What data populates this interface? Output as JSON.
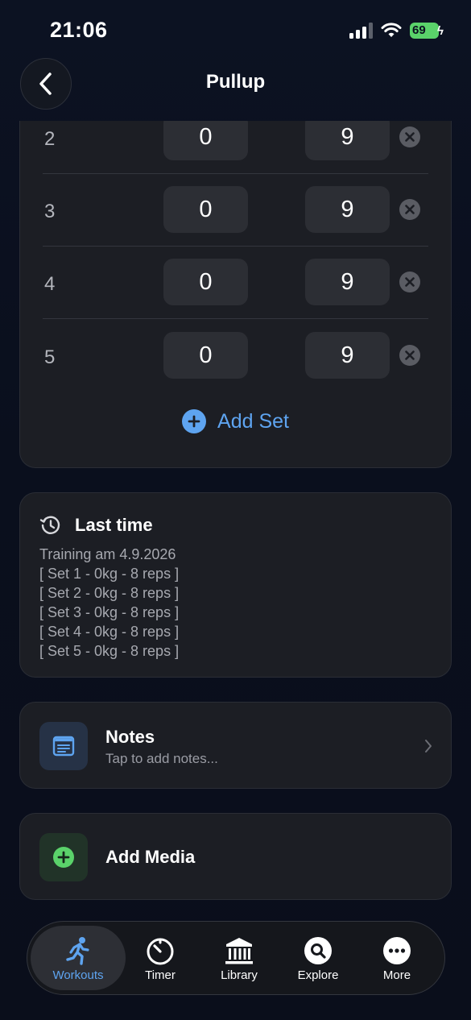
{
  "status_bar": {
    "time": "21:06",
    "battery": "69"
  },
  "header": {
    "title": "Pullup"
  },
  "sets": {
    "rows": [
      {
        "number": "2",
        "weight": "0",
        "reps": "9"
      },
      {
        "number": "3",
        "weight": "0",
        "reps": "9"
      },
      {
        "number": "4",
        "weight": "0",
        "reps": "9"
      },
      {
        "number": "5",
        "weight": "0",
        "reps": "9"
      }
    ],
    "add_label": "Add Set"
  },
  "last_time": {
    "title": "Last time",
    "lines": [
      "Training am 4.9.2026",
      "[ Set 1 - 0kg - 8 reps ]",
      "[ Set 2 - 0kg - 8 reps ]",
      "[ Set 3 - 0kg - 8 reps ]",
      "[ Set 4 - 0kg - 8 reps ]",
      "[ Set 5 - 0kg - 8 reps ]"
    ]
  },
  "notes": {
    "title": "Notes",
    "subtitle": "Tap to add notes..."
  },
  "media": {
    "title": "Add Media"
  },
  "tab_bar": {
    "tabs": [
      {
        "label": "Workouts",
        "icon": "running-person-icon",
        "active": true
      },
      {
        "label": "Timer",
        "icon": "timer-icon",
        "active": false
      },
      {
        "label": "Library",
        "icon": "library-building-icon",
        "active": false
      },
      {
        "label": "Explore",
        "icon": "search-icon",
        "active": false
      },
      {
        "label": "More",
        "icon": "more-dots-icon",
        "active": false
      }
    ]
  },
  "colors": {
    "accent": "#5ea4f0",
    "battery": "#5ad26a",
    "card": "#1c1e24",
    "background": "#0b1020"
  }
}
